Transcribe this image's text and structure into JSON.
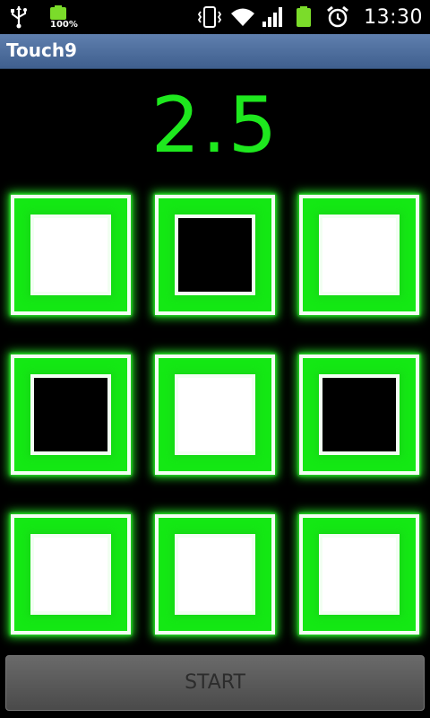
{
  "status_bar": {
    "battery_level_label": "100%",
    "time": "13:30",
    "icons": [
      "usb-icon",
      "battery-icon",
      "vibrate-icon",
      "wifi-icon",
      "signal-icon",
      "battery-icon",
      "alarm-icon"
    ]
  },
  "app": {
    "title": "Touch9"
  },
  "game": {
    "score": "2.5",
    "tiles": [
      {
        "state": "lit"
      },
      {
        "state": "dark"
      },
      {
        "state": "lit"
      },
      {
        "state": "dark"
      },
      {
        "state": "lit"
      },
      {
        "state": "dark"
      },
      {
        "state": "lit"
      },
      {
        "state": "lit"
      },
      {
        "state": "lit"
      }
    ]
  },
  "controls": {
    "start_label": "START"
  },
  "colors": {
    "accent_green": "#1ee81e",
    "titlebar": "#4f6f9e",
    "background": "#000000"
  }
}
